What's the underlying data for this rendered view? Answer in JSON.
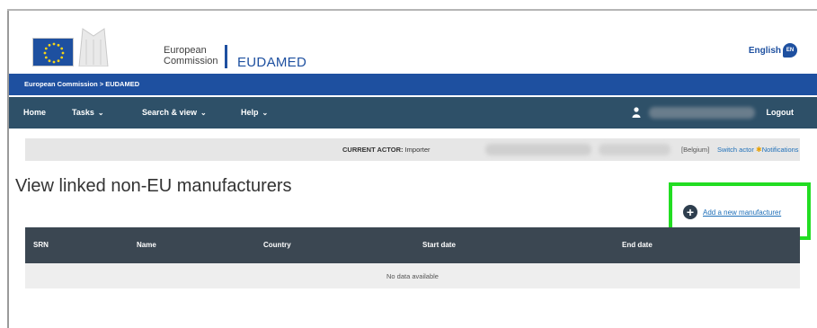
{
  "header": {
    "org_line1": "European",
    "org_line2": "Commission",
    "app_name": "EUDAMED",
    "language": "English",
    "language_code": "EN"
  },
  "breadcrumb": {
    "text": "European Commission > EUDAMED"
  },
  "nav": {
    "home": "Home",
    "tasks": "Tasks",
    "search_view": "Search & view",
    "help": "Help",
    "chevron": "⌄",
    "logout": "Logout"
  },
  "actor_bar": {
    "label": "CURRENT ACTOR:",
    "role": "Importer",
    "country": "[Belgium]",
    "switch_actor": "Switch actor",
    "notifications": "Notifications"
  },
  "page": {
    "title": "View linked non-EU manufacturers",
    "add_button_label": "Add a new manufacturer"
  },
  "table": {
    "columns": [
      "SRN",
      "Name",
      "Country",
      "Start date",
      "End date"
    ],
    "empty_message": "No data available"
  },
  "colors": {
    "brand_blue": "#1e50a0",
    "nav_bg": "#2e5068",
    "table_header_bg": "#3b4752",
    "highlight": "#22dd22",
    "link": "#1e6fb8"
  },
  "icons": {
    "user": "user-icon",
    "plus": "plus-circle-icon",
    "notifications": "bell-icon",
    "language": "speech-bubble-icon"
  }
}
